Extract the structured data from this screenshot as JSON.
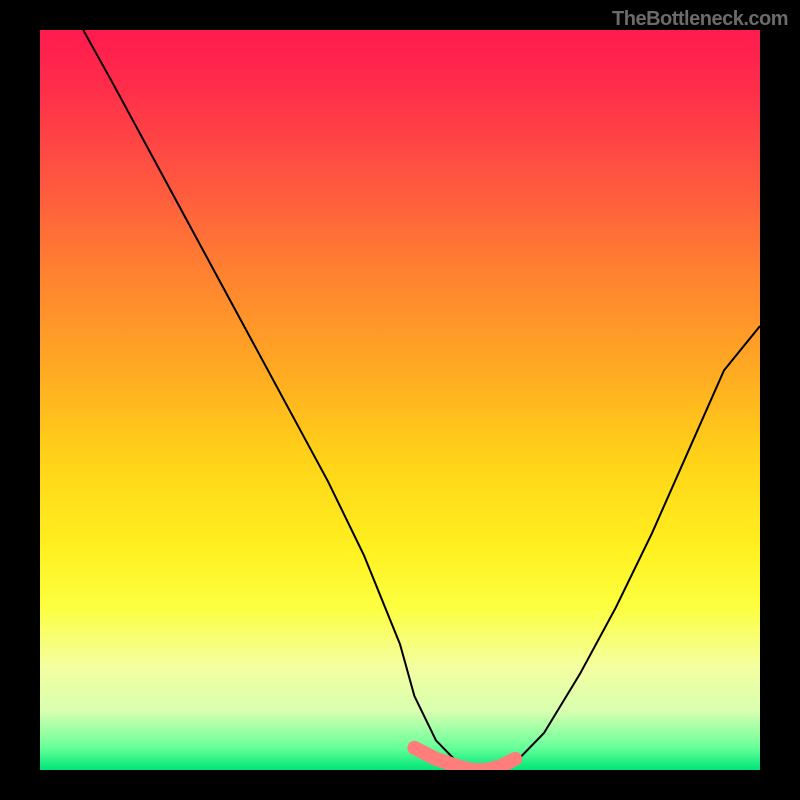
{
  "watermark": "TheBottleneck.com",
  "chart_data": {
    "type": "line",
    "title": "",
    "xlabel": "",
    "ylabel": "",
    "xlim": [
      0,
      100
    ],
    "ylim": [
      0,
      100
    ],
    "grid": false,
    "legend": false,
    "gradient_meaning": "vertical color gradient: red at top (high value / bad), yellow mid, green at bottom (low value / optimal)",
    "series": [
      {
        "name": "bottleneck-curve",
        "color": "#000000",
        "x": [
          6,
          10,
          15,
          20,
          25,
          30,
          35,
          40,
          45,
          50,
          52,
          55,
          58,
          60,
          62,
          64,
          66,
          70,
          75,
          80,
          85,
          90,
          95,
          100
        ],
        "values": [
          100,
          93,
          84,
          75,
          66,
          57,
          48,
          39,
          29,
          17,
          10,
          4,
          1,
          0,
          0,
          0,
          1,
          5,
          13,
          22,
          32,
          43,
          54,
          60
        ]
      },
      {
        "name": "bottom-highlight-band",
        "color": "#ff7a7a",
        "type": "marker-band",
        "x": [
          52,
          55,
          58,
          60,
          62,
          64,
          66
        ],
        "values": [
          3,
          1.5,
          0.5,
          0,
          0,
          0.5,
          1.5
        ],
        "note": "thick salmon highlight along trough of curve near y≈0"
      }
    ]
  }
}
